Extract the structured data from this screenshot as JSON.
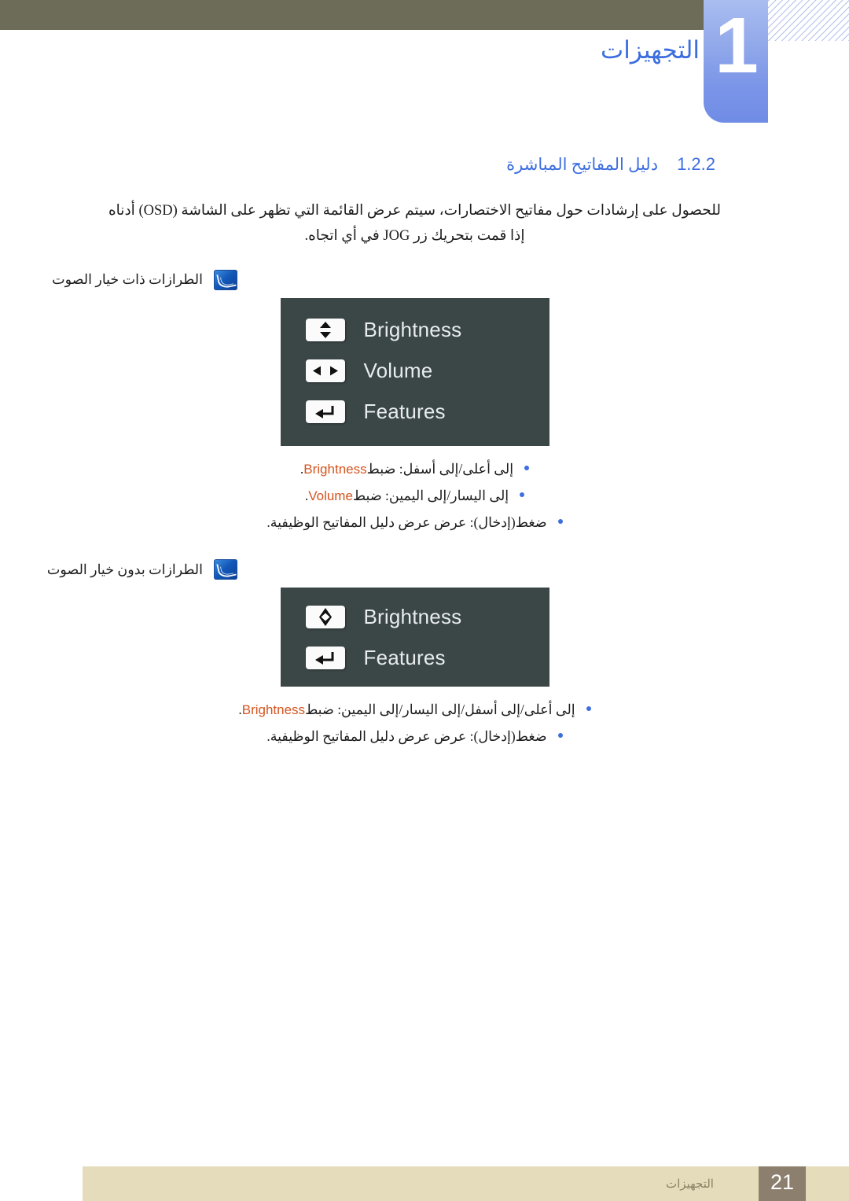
{
  "header": {
    "chapter_number": "1",
    "chapter_title": "التجهيزات"
  },
  "section": {
    "number": "1.2.2",
    "name": "دليل المفاتيح المباشرة"
  },
  "intro_paragraph": "للحصول على إرشادات حول مفاتيح الاختصارات، سيتم عرض القائمة التي تظهر على الشاشة (OSD) أدناه إذا قمت بتحريك زر JOG في أي اتجاه.",
  "blocks": [
    {
      "caption": "الطرازات ذات خيار الصوت",
      "caption_icon": "note-icon",
      "osd": {
        "rows": [
          {
            "icon": "up-down-arrows-icon",
            "label": "Brightness"
          },
          {
            "icon": "left-right-arrows-icon",
            "label": "Volume"
          },
          {
            "icon": "enter-return-icon",
            "label": "Features"
          }
        ]
      },
      "bullets": [
        {
          "pre": "إلى أعلى/إلى أسفل: ضبط",
          "keyword": "Brightness",
          "post": "."
        },
        {
          "pre": "إلى اليسار/إلى اليمين: ضبط",
          "keyword": "Volume",
          "post": "."
        },
        {
          "pre": "ضغط(إدخال): عرض عرض دليل المفاتيح الوظيفية.",
          "keyword": "",
          "post": ""
        }
      ]
    },
    {
      "caption": "الطرازات بدون خيار الصوت",
      "caption_icon": "note-icon",
      "osd": {
        "rows": [
          {
            "icon": "four-way-diamond-icon",
            "label": "Brightness"
          },
          {
            "icon": "enter-return-icon",
            "label": "Features"
          }
        ]
      },
      "bullets": [
        {
          "pre": "إلى أعلى/إلى أسفل/إلى اليسار/إلى اليمين: ضبط",
          "keyword": "Brightness",
          "post": "."
        },
        {
          "pre": "ضغط(إدخال): عرض عرض دليل المفاتيح الوظيفية.",
          "keyword": "",
          "post": ""
        }
      ]
    }
  ],
  "footer": {
    "page_number": "21",
    "chapter_label": "التجهيزات"
  },
  "colors": {
    "header_band": "#6c6c58",
    "tab_blue": "#7b95e8",
    "heading_blue": "#3d6ee0",
    "keyword_orange": "#d4541f",
    "osd_panel": "#3b4647",
    "footer_band": "#e4dcba",
    "footer_pagebox": "#8c7f6e"
  }
}
